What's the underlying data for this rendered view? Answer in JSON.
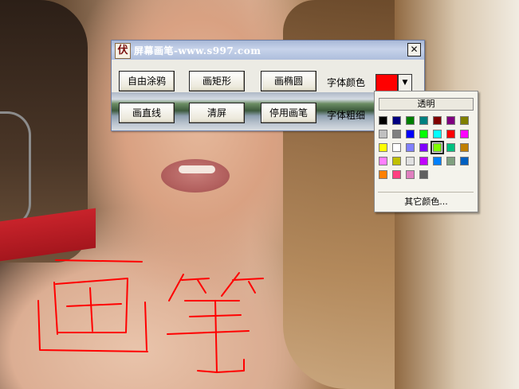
{
  "window": {
    "title": "屏幕画笔-www.s997.com",
    "icon_glyph": "伏",
    "close_glyph": "✕"
  },
  "toolbar": {
    "row1": [
      {
        "label": "自由涂鸦"
      },
      {
        "label": "画矩形"
      },
      {
        "label": "画椭圆"
      }
    ],
    "row2": [
      {
        "label": "画直线"
      },
      {
        "label": "清屏"
      },
      {
        "label": "停用画笔"
      }
    ],
    "font_color_label": "字体颜色",
    "font_width_label": "字体粗细",
    "selected_color": "#ff0000",
    "dropdown_glyph": "▼"
  },
  "color_popup": {
    "transparent_label": "透明",
    "more_colors_label": "其它颜色...",
    "selected_index": 18,
    "palette": [
      "#000000",
      "#000080",
      "#008000",
      "#008080",
      "#800000",
      "#800080",
      "#808000",
      "#c0c0c0",
      "#808080",
      "#0000ff",
      "#00ff00",
      "#00ffff",
      "#ff0000",
      "#ff00ff",
      "#ffff00",
      "#ffffff",
      "#8080ff",
      "#8000ff",
      "#80ff00",
      "#00c080",
      "#c08000",
      "#ff80ff",
      "#c0c000",
      "#e0e0e0",
      "#c000ff",
      "#0080ff",
      "#80a080",
      "#0060c0",
      "#ff8000",
      "#ff4080",
      "#e080c0",
      "#606060"
    ]
  },
  "drawing": {
    "stroke_color": "#ff0000"
  }
}
